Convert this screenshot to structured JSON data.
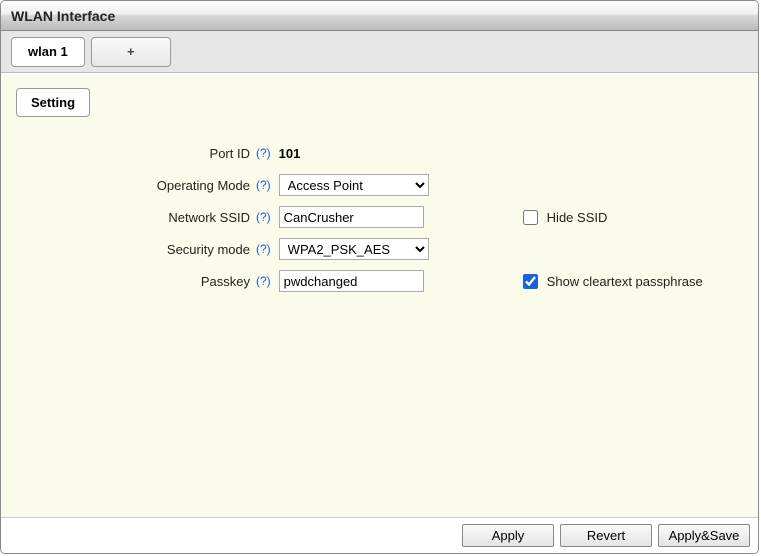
{
  "header": {
    "title": "WLAN Interface"
  },
  "tabs": {
    "active": "wlan 1",
    "add_label": "+"
  },
  "subtab": {
    "label": "Setting"
  },
  "help_token": "(?)",
  "form": {
    "port_id": {
      "label": "Port ID",
      "value": "101"
    },
    "operating_mode": {
      "label": "Operating Mode",
      "value": "Access Point"
    },
    "network_ssid": {
      "label": "Network SSID",
      "value": "CanCrusher"
    },
    "hide_ssid": {
      "label": "Hide SSID",
      "checked": false
    },
    "security_mode": {
      "label": "Security mode",
      "value": "WPA2_PSK_AES"
    },
    "passkey": {
      "label": "Passkey",
      "value": "pwdchanged"
    },
    "show_cleartext": {
      "label": "Show cleartext passphrase",
      "checked": true
    }
  },
  "footer": {
    "apply": "Apply",
    "revert": "Revert",
    "apply_save": "Apply&Save"
  }
}
